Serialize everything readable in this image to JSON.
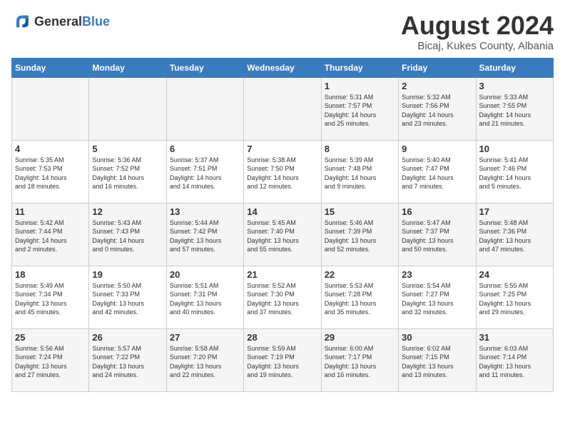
{
  "header": {
    "logo": {
      "general": "General",
      "blue": "Blue"
    },
    "title": "August 2024",
    "location": "Bicaj, Kukes County, Albania"
  },
  "calendar": {
    "days_of_week": [
      "Sunday",
      "Monday",
      "Tuesday",
      "Wednesday",
      "Thursday",
      "Friday",
      "Saturday"
    ],
    "weeks": [
      [
        {
          "day": "",
          "info": ""
        },
        {
          "day": "",
          "info": ""
        },
        {
          "day": "",
          "info": ""
        },
        {
          "day": "",
          "info": ""
        },
        {
          "day": "1",
          "info": "Sunrise: 5:31 AM\nSunset: 7:57 PM\nDaylight: 14 hours\nand 25 minutes."
        },
        {
          "day": "2",
          "info": "Sunrise: 5:32 AM\nSunset: 7:56 PM\nDaylight: 14 hours\nand 23 minutes."
        },
        {
          "day": "3",
          "info": "Sunrise: 5:33 AM\nSunset: 7:55 PM\nDaylight: 14 hours\nand 21 minutes."
        }
      ],
      [
        {
          "day": "4",
          "info": "Sunrise: 5:35 AM\nSunset: 7:53 PM\nDaylight: 14 hours\nand 18 minutes."
        },
        {
          "day": "5",
          "info": "Sunrise: 5:36 AM\nSunset: 7:52 PM\nDaylight: 14 hours\nand 16 minutes."
        },
        {
          "day": "6",
          "info": "Sunrise: 5:37 AM\nSunset: 7:51 PM\nDaylight: 14 hours\nand 14 minutes."
        },
        {
          "day": "7",
          "info": "Sunrise: 5:38 AM\nSunset: 7:50 PM\nDaylight: 14 hours\nand 12 minutes."
        },
        {
          "day": "8",
          "info": "Sunrise: 5:39 AM\nSunset: 7:48 PM\nDaylight: 14 hours\nand 9 minutes."
        },
        {
          "day": "9",
          "info": "Sunrise: 5:40 AM\nSunset: 7:47 PM\nDaylight: 14 hours\nand 7 minutes."
        },
        {
          "day": "10",
          "info": "Sunrise: 5:41 AM\nSunset: 7:46 PM\nDaylight: 14 hours\nand 5 minutes."
        }
      ],
      [
        {
          "day": "11",
          "info": "Sunrise: 5:42 AM\nSunset: 7:44 PM\nDaylight: 14 hours\nand 2 minutes."
        },
        {
          "day": "12",
          "info": "Sunrise: 5:43 AM\nSunset: 7:43 PM\nDaylight: 14 hours\nand 0 minutes."
        },
        {
          "day": "13",
          "info": "Sunrise: 5:44 AM\nSunset: 7:42 PM\nDaylight: 13 hours\nand 57 minutes."
        },
        {
          "day": "14",
          "info": "Sunrise: 5:45 AM\nSunset: 7:40 PM\nDaylight: 13 hours\nand 55 minutes."
        },
        {
          "day": "15",
          "info": "Sunrise: 5:46 AM\nSunset: 7:39 PM\nDaylight: 13 hours\nand 52 minutes."
        },
        {
          "day": "16",
          "info": "Sunrise: 5:47 AM\nSunset: 7:37 PM\nDaylight: 13 hours\nand 50 minutes."
        },
        {
          "day": "17",
          "info": "Sunrise: 5:48 AM\nSunset: 7:36 PM\nDaylight: 13 hours\nand 47 minutes."
        }
      ],
      [
        {
          "day": "18",
          "info": "Sunrise: 5:49 AM\nSunset: 7:34 PM\nDaylight: 13 hours\nand 45 minutes."
        },
        {
          "day": "19",
          "info": "Sunrise: 5:50 AM\nSunset: 7:33 PM\nDaylight: 13 hours\nand 42 minutes."
        },
        {
          "day": "20",
          "info": "Sunrise: 5:51 AM\nSunset: 7:31 PM\nDaylight: 13 hours\nand 40 minutes."
        },
        {
          "day": "21",
          "info": "Sunrise: 5:52 AM\nSunset: 7:30 PM\nDaylight: 13 hours\nand 37 minutes."
        },
        {
          "day": "22",
          "info": "Sunrise: 5:53 AM\nSunset: 7:28 PM\nDaylight: 13 hours\nand 35 minutes."
        },
        {
          "day": "23",
          "info": "Sunrise: 5:54 AM\nSunset: 7:27 PM\nDaylight: 13 hours\nand 32 minutes."
        },
        {
          "day": "24",
          "info": "Sunrise: 5:55 AM\nSunset: 7:25 PM\nDaylight: 13 hours\nand 29 minutes."
        }
      ],
      [
        {
          "day": "25",
          "info": "Sunrise: 5:56 AM\nSunset: 7:24 PM\nDaylight: 13 hours\nand 27 minutes."
        },
        {
          "day": "26",
          "info": "Sunrise: 5:57 AM\nSunset: 7:22 PM\nDaylight: 13 hours\nand 24 minutes."
        },
        {
          "day": "27",
          "info": "Sunrise: 5:58 AM\nSunset: 7:20 PM\nDaylight: 13 hours\nand 22 minutes."
        },
        {
          "day": "28",
          "info": "Sunrise: 5:59 AM\nSunset: 7:19 PM\nDaylight: 13 hours\nand 19 minutes."
        },
        {
          "day": "29",
          "info": "Sunrise: 6:00 AM\nSunset: 7:17 PM\nDaylight: 13 hours\nand 16 minutes."
        },
        {
          "day": "30",
          "info": "Sunrise: 6:02 AM\nSunset: 7:15 PM\nDaylight: 13 hours\nand 13 minutes."
        },
        {
          "day": "31",
          "info": "Sunrise: 6:03 AM\nSunset: 7:14 PM\nDaylight: 13 hours\nand 11 minutes."
        }
      ]
    ]
  }
}
